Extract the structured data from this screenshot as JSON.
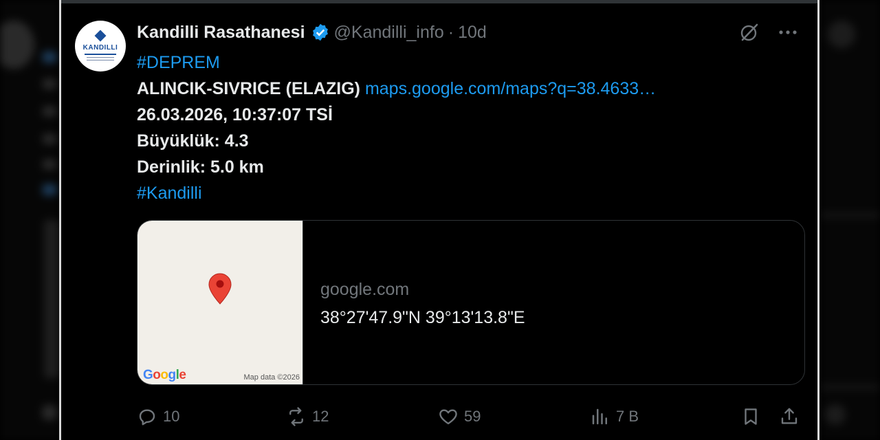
{
  "tweet": {
    "author_name": "Kandilli Rasathanesi",
    "handle": "@Kandilli_info",
    "separator": "·",
    "time": "10d",
    "avatar_text": "KANDILLI",
    "hashtag1": "#DEPREM",
    "location": "ALINCIK-SIVRICE (ELAZIG)",
    "link": "maps.google.com/maps?q=38.4633…",
    "datetime": "26.03.2026, 10:37:07 TSİ",
    "magnitude": "Büyüklük: 4.3",
    "depth": "Derinlik: 5.0 km",
    "hashtag2": "#Kandilli"
  },
  "card": {
    "domain": "google.com",
    "title": "38°27'47.9\"N 39°13'13.8\"E",
    "map_logo": "Google",
    "map_data": "Map data ©2026"
  },
  "actions": {
    "replies": "10",
    "reposts": "12",
    "likes": "59",
    "views": "7 B"
  },
  "colors": {
    "accent": "#1d9bf0",
    "muted": "#71767b",
    "text": "#e7e9ea",
    "background": "#000000",
    "map_bg": "#f2efe9",
    "pin": "#ea4335"
  },
  "icons": {
    "verified": "verified-badge-icon",
    "grok": "grok-icon",
    "more": "more-icon",
    "reply": "reply-icon",
    "repost": "repost-icon",
    "like": "like-icon",
    "views": "views-icon",
    "bookmark": "bookmark-icon",
    "share": "share-icon",
    "pin": "map-pin-icon"
  }
}
